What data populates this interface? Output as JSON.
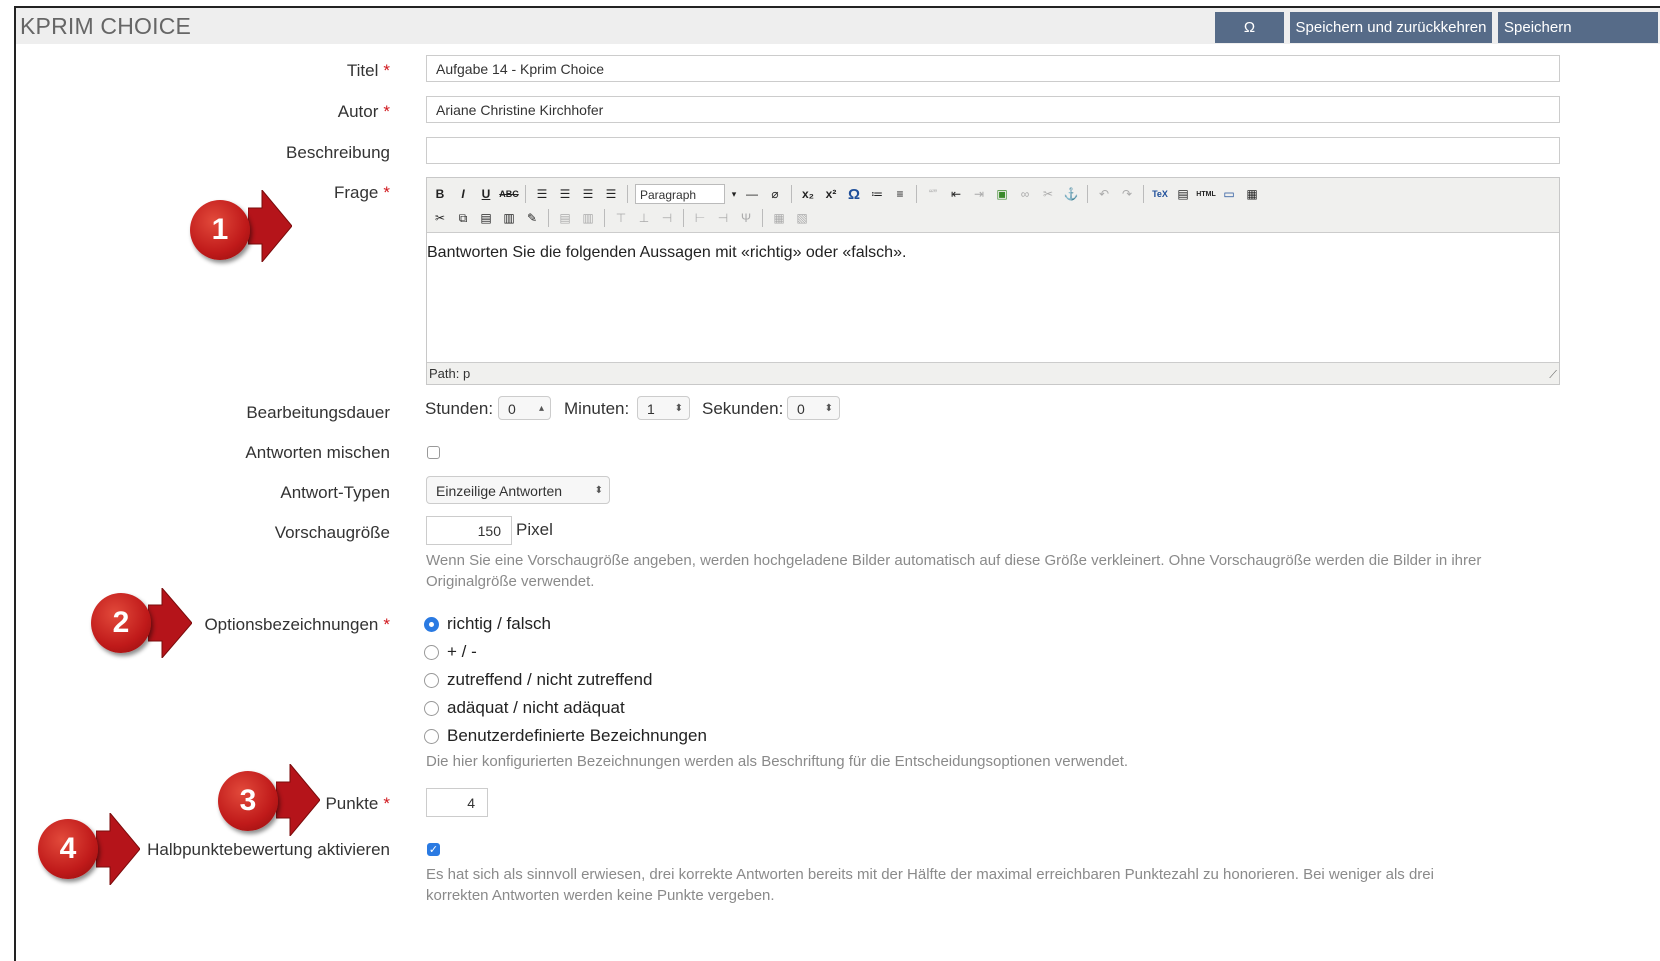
{
  "app": {
    "title": "KPRIM CHOICE"
  },
  "header": {
    "omega_label": "Ω",
    "save_return_label": "Speichern und zurückkehren",
    "save_label": "Speichern"
  },
  "form": {
    "titel_label": "Titel",
    "titel_value": "Aufgabe 14 - Kprim Choice",
    "autor_label": "Autor",
    "autor_value": "Ariane Christine Kirchhofer",
    "beschreibung_label": "Beschreibung",
    "beschreibung_value": "",
    "frage_label": "Frage",
    "required_mark": "*",
    "editor": {
      "format_select": "Paragraph",
      "content": "Bantworten Sie die folgenden Aussagen mit «richtig» oder «falsch».",
      "path": "Path: p"
    },
    "bearbeitungsdauer_label": "Bearbeitungsdauer",
    "stunden_label": "Stunden:",
    "stunden_value": "0",
    "minuten_label": "Minuten:",
    "minuten_value": "1",
    "sekunden_label": "Sekunden:",
    "sekunden_value": "0",
    "antworten_mischen_label": "Antworten mischen",
    "antworten_mischen_checked": false,
    "antwort_typen_label": "Antwort-Typen",
    "antwort_typen_value": "Einzeilige Antworten",
    "vorschaugroesse_label": "Vorschaugröße",
    "vorschaugroesse_value": "150",
    "vorschaugroesse_unit": "Pixel",
    "vorschaugroesse_help_1": "Wenn Sie eine Vorschaugröße angeben, werden hochgeladene Bilder automatisch auf diese Größe verkleinert. Ohne Vorschaugröße werden die Bilder in ihrer",
    "vorschaugroesse_help_2": "Originalgröße verwendet.",
    "optionsbezeichnungen_label": "Optionsbezeichnungen",
    "options": [
      {
        "label": "richtig / falsch",
        "selected": true
      },
      {
        "label": "+ / -",
        "selected": false
      },
      {
        "label": "zutreffend / nicht zutreffend",
        "selected": false
      },
      {
        "label": "adäquat / nicht adäquat",
        "selected": false
      },
      {
        "label": "Benutzerdefinierte Bezeichnungen",
        "selected": false
      }
    ],
    "options_help": "Die hier konfigurierten Bezeichnungen werden als Beschriftung für die Entscheidungsoptionen verwendet.",
    "punkte_label": "Punkte",
    "punkte_value": "4",
    "halbpunkte_label": "Halbpunktebewertung aktivieren",
    "halbpunkte_checked": true,
    "halbpunkte_help_1": "Es hat sich als sinnvoll erwiesen, drei korrekte Antworten bereits mit der Hälfte der maximal erreichbaren Punktezahl zu honorieren. Bei weniger als drei",
    "halbpunkte_help_2": "korrekten Antworten werden keine Punkte vergeben."
  },
  "callouts": [
    "1",
    "2",
    "3",
    "4"
  ],
  "colors": {
    "header_button": "#566b88",
    "callout": "#c01a1a",
    "required": "#d0161c",
    "accent": "#2a7ae2"
  }
}
